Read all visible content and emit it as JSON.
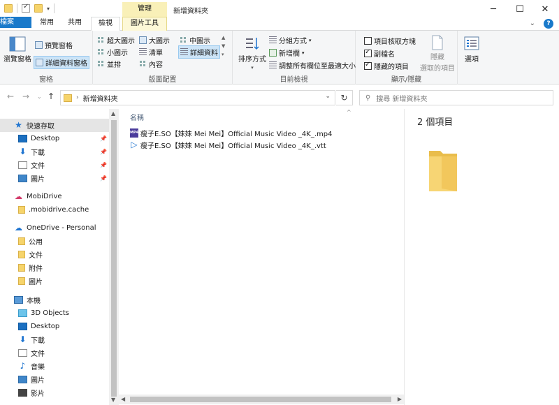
{
  "titlebar": {
    "context_tab_title": "管理",
    "window_title": "新增資料夾",
    "minimize": "─",
    "maximize": "☐",
    "close": "✕"
  },
  "tabs": {
    "file": "檔案",
    "home": "常用",
    "share": "共用",
    "view": "檢視",
    "picture_tools": "圖片工具"
  },
  "ribbon": {
    "panes": {
      "nav_pane": "瀏覽窗格",
      "preview_pane": "預覽窗格",
      "details_pane": "詳細資料窗格",
      "label": "窗格"
    },
    "layout": {
      "extra_large_icons": "超大圖示",
      "large_icons": "大圖示",
      "medium_icons": "中圖示",
      "small_icons": "小圖示",
      "list": "清單",
      "details": "詳細資料",
      "tiles": "並排",
      "content": "內容",
      "label": "版面配置"
    },
    "current_view": {
      "sort_by": "排序方式",
      "group_by": "分組方式",
      "add_columns": "新增欄",
      "size_columns": "調整所有欄位至最適大小",
      "label": "目前檢視"
    },
    "show_hide": {
      "item_checkboxes": "項目核取方塊",
      "file_extensions": "副檔名",
      "hidden_items": "隱藏的項目",
      "hide_selected_line1": "隱藏",
      "hide_selected_line2": "選取的項目",
      "label": "顯示/隱藏"
    },
    "options": "選項"
  },
  "address": {
    "path": "新增資料夾",
    "search_placeholder": "搜尋 新增資料夾"
  },
  "nav": {
    "quick_access": "快速存取",
    "qa_items": [
      "Desktop",
      "下載",
      "文件",
      "圖片"
    ],
    "mobidrive": "MobiDrive",
    "mobidrive_cache": ".mobidrive.cache",
    "onedrive": "OneDrive - Personal",
    "onedrive_items": [
      "公用",
      "文件",
      "附件",
      "圖片"
    ],
    "this_pc": "本機",
    "pc_items": [
      "3D Objects",
      "Desktop",
      "下載",
      "文件",
      "音樂",
      "圖片",
      "影片"
    ]
  },
  "filelist": {
    "column_name": "名稱",
    "files": [
      "瘦子E.SO【妹妹 Mei Mei】Official Music Video _4K_.mp4",
      "瘦子E.SO【妹妹 Mei Mei】Official Music Video _4K_.vtt"
    ]
  },
  "preview": {
    "count": "2 個項目"
  }
}
